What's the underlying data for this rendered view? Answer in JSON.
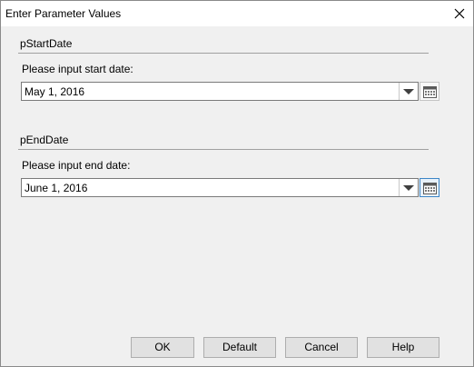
{
  "dialog": {
    "title": "Enter Parameter Values",
    "close_icon": "close-icon"
  },
  "params": [
    {
      "name": "pStartDate",
      "prompt": "Please input start date:",
      "value": "May 1, 2016",
      "calendar_icon": "calendar-icon"
    },
    {
      "name": "pEndDate",
      "prompt": "Please input end date:",
      "value": "June 1, 2016",
      "calendar_icon": "calendar-icon"
    }
  ],
  "buttons": {
    "ok": "OK",
    "default": "Default",
    "cancel": "Cancel",
    "help": "Help"
  },
  "colors": {
    "dialog_bg": "#f0f0f0",
    "focus_accent": "#3d86c6"
  }
}
